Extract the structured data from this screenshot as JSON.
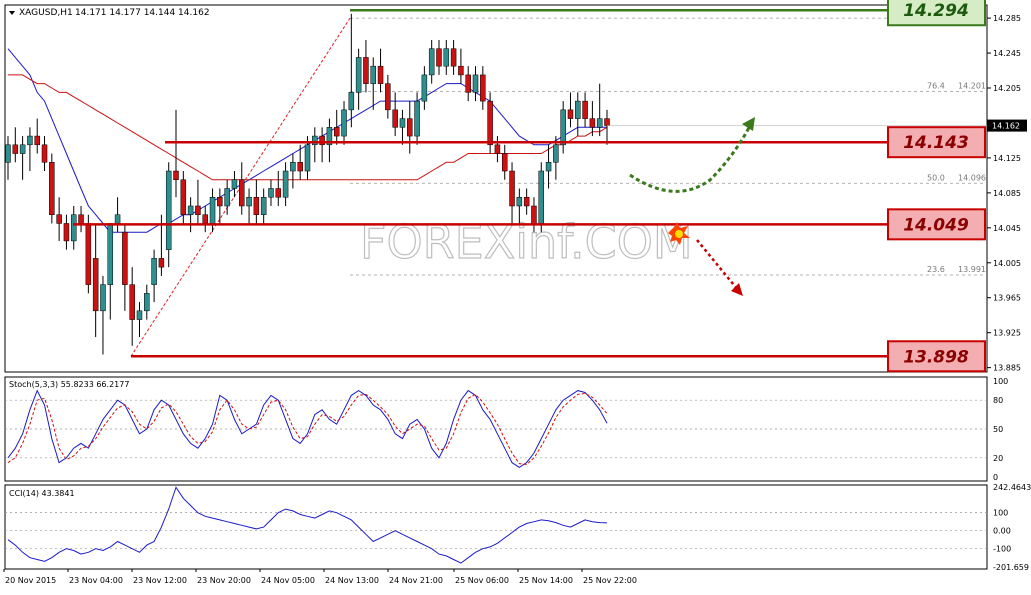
{
  "header": {
    "title": "XAGUSD,H1",
    "ohlc": "14.171 14.177 14.144 14.162"
  },
  "watermark": "FOREXinf.COM",
  "colors": {
    "bull": "#2f8f8f",
    "bear": "#cc1111",
    "sma_fast": "#1a1acc",
    "sma_slow": "#cc1111",
    "level_red": "#c80000",
    "level_fill_red": "#f2aeb0",
    "level_green": "#3a7a1a",
    "level_fill_green": "#d6ecc4",
    "fib": "#999999",
    "stoch_main": "#1a1acc",
    "stoch_signal": "#cc1111",
    "cci": "#1a1acc"
  },
  "levels": [
    {
      "label": "14.294",
      "value": 14.294,
      "color": "green"
    },
    {
      "label": "14.143",
      "value": 14.143,
      "color": "red"
    },
    {
      "label": "14.049",
      "value": 14.049,
      "color": "red"
    },
    {
      "label": "13.898",
      "value": 13.898,
      "color": "red"
    }
  ],
  "fib_levels": [
    {
      "ratio": "76.4",
      "value": "14.201",
      "v": 14.201
    },
    {
      "ratio": "50.0",
      "value": "14.096",
      "v": 14.096
    },
    {
      "ratio": "23.6",
      "value": "13.991",
      "v": 13.991
    }
  ],
  "current_price": "14.162",
  "chart_data": [
    {
      "type": "candlestick",
      "title": "XAGUSD,H1",
      "y_ticks": [
        "14.285",
        "14.245",
        "14.205",
        "14.165",
        "14.125",
        "14.085",
        "14.045",
        "14.005",
        "13.965",
        "13.925",
        "13.885"
      ],
      "ylim": [
        13.88,
        14.3
      ],
      "x_labels": [
        "20 Nov 2015",
        "23 Nov 04:00",
        "23 Nov 12:00",
        "23 Nov 20:00",
        "24 Nov 05:00",
        "24 Nov 13:00",
        "24 Nov 21:00",
        "25 Nov 06:00",
        "25 Nov 14:00",
        "25 Nov 22:00"
      ],
      "candles": [
        [
          14.12,
          14.15,
          14.1,
          14.14
        ],
        [
          14.14,
          14.16,
          14.12,
          14.13
        ],
        [
          14.13,
          14.15,
          14.1,
          14.14
        ],
        [
          14.14,
          14.16,
          14.11,
          14.15
        ],
        [
          14.15,
          14.17,
          14.13,
          14.14
        ],
        [
          14.14,
          14.15,
          14.11,
          14.12
        ],
        [
          14.12,
          14.13,
          14.05,
          14.06
        ],
        [
          14.06,
          14.08,
          14.03,
          14.05
        ],
        [
          14.05,
          14.06,
          14.02,
          14.03
        ],
        [
          14.03,
          14.07,
          14.02,
          14.06
        ],
        [
          14.06,
          14.07,
          14.04,
          14.05
        ],
        [
          14.05,
          14.06,
          13.97,
          13.98
        ],
        [
          14.01,
          14.05,
          13.92,
          13.95
        ],
        [
          13.95,
          13.99,
          13.9,
          13.98
        ],
        [
          13.98,
          14.05,
          13.94,
          14.05
        ],
        [
          14.05,
          14.08,
          14.04,
          14.06
        ],
        [
          14.04,
          14.05,
          13.95,
          13.98
        ],
        [
          13.98,
          14.0,
          13.91,
          13.94
        ],
        [
          13.94,
          13.96,
          13.92,
          13.95
        ],
        [
          13.95,
          13.98,
          13.94,
          13.97
        ],
        [
          13.98,
          14.02,
          13.96,
          14.01
        ],
        [
          14.01,
          14.06,
          13.99,
          14.0
        ],
        [
          14.02,
          14.12,
          14.0,
          14.11
        ],
        [
          14.11,
          14.18,
          14.08,
          14.1
        ],
        [
          14.1,
          14.11,
          14.05,
          14.06
        ],
        [
          14.06,
          14.08,
          14.04,
          14.07
        ],
        [
          14.07,
          14.1,
          14.05,
          14.06
        ],
        [
          14.06,
          14.07,
          14.04,
          14.05
        ],
        [
          14.05,
          14.09,
          14.04,
          14.08
        ],
        [
          14.08,
          14.09,
          14.05,
          14.07
        ],
        [
          14.07,
          14.1,
          14.06,
          14.09
        ],
        [
          14.09,
          14.11,
          14.08,
          14.1
        ],
        [
          14.1,
          14.12,
          14.06,
          14.07
        ],
        [
          14.07,
          14.09,
          14.05,
          14.08
        ],
        [
          14.08,
          14.1,
          14.05,
          14.06
        ],
        [
          14.06,
          14.09,
          14.05,
          14.08
        ],
        [
          14.08,
          14.1,
          14.07,
          14.09
        ],
        [
          14.09,
          14.11,
          14.07,
          14.08
        ],
        [
          14.08,
          14.12,
          14.07,
          14.11
        ],
        [
          14.11,
          14.13,
          14.09,
          14.12
        ],
        [
          14.12,
          14.14,
          14.1,
          14.11
        ],
        [
          14.11,
          14.15,
          14.1,
          14.14
        ],
        [
          14.14,
          14.16,
          14.12,
          14.15
        ],
        [
          14.15,
          14.16,
          14.12,
          14.14
        ],
        [
          14.14,
          14.17,
          14.12,
          14.16
        ],
        [
          14.16,
          14.18,
          14.14,
          14.15
        ],
        [
          14.15,
          14.19,
          14.14,
          14.18
        ],
        [
          14.18,
          14.29,
          14.16,
          14.2
        ],
        [
          14.2,
          14.25,
          14.18,
          14.24
        ],
        [
          14.24,
          14.26,
          14.2,
          14.21
        ],
        [
          14.21,
          14.24,
          14.18,
          14.23
        ],
        [
          14.23,
          14.25,
          14.2,
          14.21
        ],
        [
          14.21,
          14.22,
          14.17,
          14.18
        ],
        [
          14.18,
          14.2,
          14.15,
          14.16
        ],
        [
          14.16,
          14.18,
          14.14,
          14.17
        ],
        [
          14.17,
          14.19,
          14.13,
          14.15
        ],
        [
          14.15,
          14.2,
          14.14,
          14.19
        ],
        [
          14.19,
          14.23,
          14.18,
          14.22
        ],
        [
          14.22,
          14.26,
          14.21,
          14.25
        ],
        [
          14.25,
          14.26,
          14.22,
          14.23
        ],
        [
          14.23,
          14.26,
          14.22,
          14.25
        ],
        [
          14.25,
          14.26,
          14.22,
          14.23
        ],
        [
          14.23,
          14.25,
          14.21,
          14.22
        ],
        [
          14.22,
          14.23,
          14.19,
          14.2
        ],
        [
          14.2,
          14.23,
          14.19,
          14.22
        ],
        [
          14.22,
          14.23,
          14.18,
          14.19
        ],
        [
          14.19,
          14.2,
          14.13,
          14.14
        ],
        [
          14.14,
          14.15,
          14.12,
          14.13
        ],
        [
          14.13,
          14.14,
          14.1,
          14.11
        ],
        [
          14.11,
          14.12,
          14.05,
          14.07
        ],
        [
          14.07,
          14.09,
          14.05,
          14.08
        ],
        [
          14.08,
          14.09,
          14.06,
          14.07
        ],
        [
          14.07,
          14.08,
          14.04,
          14.05
        ],
        [
          14.05,
          14.12,
          14.04,
          14.11
        ],
        [
          14.11,
          14.14,
          14.09,
          14.12
        ],
        [
          14.12,
          14.15,
          14.1,
          14.14
        ],
        [
          14.14,
          14.19,
          14.13,
          14.18
        ],
        [
          14.18,
          14.2,
          14.16,
          14.17
        ],
        [
          14.17,
          14.2,
          14.15,
          14.19
        ],
        [
          14.19,
          14.2,
          14.16,
          14.17
        ],
        [
          14.17,
          14.19,
          14.15,
          14.16
        ],
        [
          14.16,
          14.21,
          14.15,
          14.17
        ],
        [
          14.17,
          14.18,
          14.14,
          14.162
        ]
      ],
      "series": [
        {
          "name": "",
          "kind": "sma_fast",
          "values": [
            14.25,
            14.24,
            14.23,
            14.22,
            14.2,
            14.19,
            14.17,
            14.15,
            14.13,
            14.11,
            14.09,
            14.07,
            14.06,
            14.05,
            14.04,
            14.04,
            14.04,
            14.04,
            14.04,
            14.04,
            14.045,
            14.05,
            14.05,
            14.055,
            14.06,
            14.06,
            14.065,
            14.07,
            14.075,
            14.08,
            14.085,
            14.09,
            14.095,
            14.1,
            14.105,
            14.11,
            14.115,
            14.12,
            14.125,
            14.13,
            14.135,
            14.14,
            14.145,
            14.15,
            14.155,
            14.16,
            14.165,
            14.17,
            14.175,
            14.18,
            14.185,
            14.19,
            14.19,
            14.19,
            14.19,
            14.19,
            14.19,
            14.195,
            14.2,
            14.205,
            14.21,
            14.21,
            14.21,
            14.205,
            14.2,
            14.195,
            14.19,
            14.18,
            14.17,
            14.16,
            14.15,
            14.145,
            14.14,
            14.14,
            14.14,
            14.145,
            14.15,
            14.155,
            14.16,
            14.16,
            14.16,
            14.16,
            14.16
          ]
        },
        {
          "name": "",
          "kind": "sma_slow",
          "values": [
            14.22,
            14.22,
            14.22,
            14.215,
            14.21,
            14.21,
            14.205,
            14.2,
            14.2,
            14.195,
            14.19,
            14.185,
            14.18,
            14.175,
            14.17,
            14.165,
            14.16,
            14.155,
            14.15,
            14.145,
            14.14,
            14.135,
            14.13,
            14.125,
            14.12,
            14.115,
            14.11,
            14.105,
            14.1,
            14.1,
            14.1,
            14.1,
            14.1,
            14.1,
            14.1,
            14.1,
            14.1,
            14.1,
            14.1,
            14.1,
            14.1,
            14.1,
            14.1,
            14.1,
            14.1,
            14.1,
            14.1,
            14.1,
            14.1,
            14.1,
            14.1,
            14.1,
            14.1,
            14.1,
            14.1,
            14.1,
            14.1,
            14.105,
            14.11,
            14.115,
            14.12,
            14.12,
            14.125,
            14.13,
            14.13,
            14.13,
            14.13,
            14.13,
            14.13,
            14.13,
            14.13,
            14.13,
            14.13,
            14.13,
            14.135,
            14.14,
            14.14,
            14.145,
            14.15,
            14.15,
            14.155,
            14.155,
            14.16
          ]
        }
      ]
    },
    {
      "type": "line",
      "title": "Stoch(5,3,3) 55.8233 66.2177",
      "ylim": [
        0,
        100
      ],
      "y_ticks": [
        "100",
        "80",
        "50",
        "20",
        "0"
      ],
      "series": [
        {
          "name": "",
          "kind": "main",
          "values": [
            20,
            30,
            45,
            70,
            90,
            75,
            40,
            15,
            20,
            30,
            35,
            30,
            45,
            60,
            70,
            80,
            75,
            60,
            45,
            50,
            70,
            80,
            75,
            60,
            45,
            35,
            30,
            40,
            55,
            85,
            80,
            60,
            45,
            50,
            55,
            75,
            85,
            80,
            60,
            40,
            35,
            45,
            65,
            70,
            60,
            55,
            70,
            85,
            90,
            85,
            75,
            70,
            60,
            45,
            40,
            55,
            60,
            50,
            30,
            20,
            35,
            60,
            80,
            90,
            85,
            70,
            60,
            45,
            30,
            15,
            10,
            15,
            25,
            40,
            55,
            70,
            80,
            85,
            90,
            88,
            80,
            70,
            56
          ]
        },
        {
          "name": "",
          "kind": "signal",
          "values": [
            15,
            20,
            35,
            55,
            80,
            82,
            60,
            30,
            18,
            22,
            30,
            32,
            40,
            52,
            62,
            72,
            75,
            68,
            55,
            50,
            58,
            72,
            76,
            68,
            55,
            42,
            35,
            37,
            47,
            70,
            80,
            70,
            55,
            50,
            52,
            65,
            78,
            80,
            70,
            52,
            40,
            42,
            55,
            65,
            63,
            58,
            63,
            75,
            85,
            86,
            80,
            73,
            65,
            53,
            45,
            50,
            55,
            53,
            40,
            28,
            30,
            45,
            67,
            82,
            86,
            78,
            67,
            55,
            40,
            25,
            14,
            13,
            20,
            32,
            46,
            62,
            73,
            80,
            86,
            87,
            83,
            75,
            66
          ]
        }
      ]
    },
    {
      "type": "line",
      "title": "CCI(14) 43.3841",
      "ylim": [
        -201.659,
        242.4643
      ],
      "y_ticks": [
        "242.4643",
        "100",
        "0.00",
        "-100",
        "-201.659"
      ],
      "series": [
        {
          "name": "",
          "kind": "cci",
          "values": [
            -50,
            -80,
            -120,
            -150,
            -160,
            -170,
            -150,
            -120,
            -100,
            -110,
            -130,
            -120,
            -100,
            -110,
            -90,
            -60,
            -80,
            -100,
            -120,
            -80,
            -60,
            20,
            120,
            240,
            180,
            140,
            100,
            80,
            70,
            60,
            50,
            40,
            30,
            20,
            10,
            20,
            60,
            100,
            120,
            110,
            90,
            80,
            70,
            90,
            110,
            100,
            80,
            60,
            20,
            -20,
            -60,
            -40,
            -20,
            0,
            -20,
            -40,
            -60,
            -80,
            -100,
            -130,
            -140,
            -160,
            -180,
            -150,
            -120,
            -100,
            -90,
            -70,
            -40,
            -10,
            20,
            40,
            50,
            60,
            55,
            45,
            30,
            20,
            40,
            60,
            50,
            45,
            43
          ]
        }
      ]
    }
  ]
}
